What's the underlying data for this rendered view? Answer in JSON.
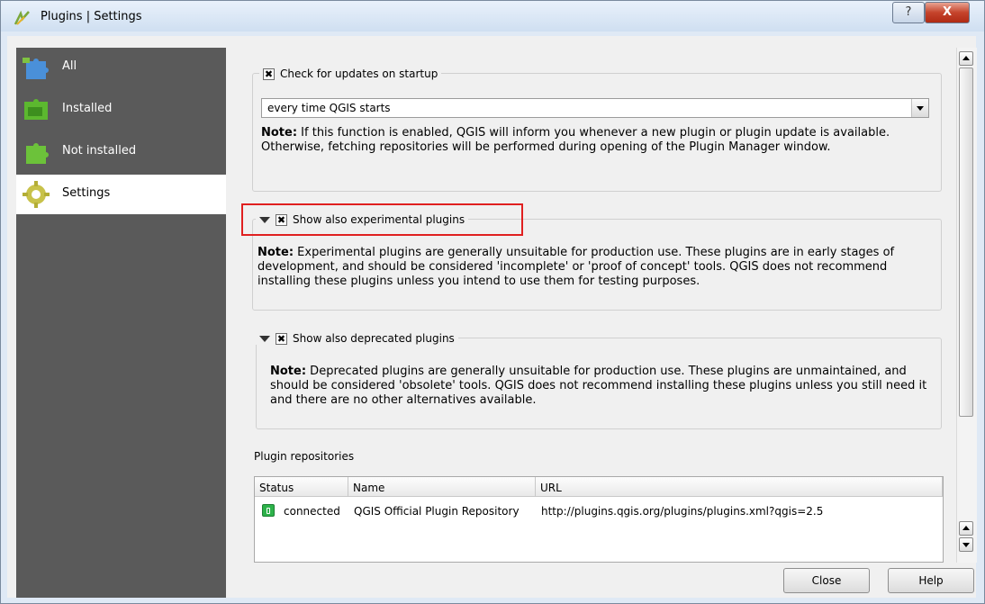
{
  "window": {
    "title": "Plugins | Settings",
    "help_glyph": "?",
    "close_glyph": "X"
  },
  "sidebar": {
    "items": [
      {
        "label": "All",
        "icon": "puzzle-all-icon"
      },
      {
        "label": "Installed",
        "icon": "puzzle-installed-icon"
      },
      {
        "label": "Not installed",
        "icon": "puzzle-not-installed-icon"
      },
      {
        "label": "Settings",
        "icon": "gear-icon",
        "active": true
      }
    ]
  },
  "updates": {
    "checkbox_label": "Check for updates on startup",
    "checked": true,
    "frequency": "every time QGIS starts",
    "note_bold": "Note:",
    "note_text": " If this function is enabled, QGIS will inform you whenever a new plugin or plugin update is available. Otherwise, fetching repositories will be performed during opening of the Plugin Manager window."
  },
  "experimental": {
    "checkbox_label": "Show also experimental plugins",
    "checked": true,
    "note_bold": "Note:",
    "note_text": " Experimental plugins are generally unsuitable for production use. These plugins are in early stages of development, and should be considered 'incomplete' or 'proof of concept' tools. QGIS does not recommend installing these plugins unless you intend to use them for testing purposes."
  },
  "deprecated": {
    "checkbox_label": "Show also deprecated plugins",
    "checked": true,
    "note_bold": "Note:",
    "note_text": " Deprecated plugins are generally unsuitable for production use. These plugins are unmaintained, and should be considered 'obsolete' tools. QGIS does not recommend installing these plugins unless you still need it and there are no other alternatives available."
  },
  "repositories": {
    "label": "Plugin repositories",
    "columns": [
      "Status",
      "Name",
      "URL"
    ],
    "rows": [
      {
        "status": "connected",
        "name": "QGIS Official Plugin Repository",
        "url": "http://plugins.qgis.org/plugins/plugins.xml?qgis=2.5"
      }
    ]
  },
  "buttons": {
    "close": "Close",
    "help": "Help"
  },
  "colors": {
    "sidebar_bg": "#5a5a5a",
    "highlight": "#e02020",
    "status_connected": "#2db24a"
  }
}
